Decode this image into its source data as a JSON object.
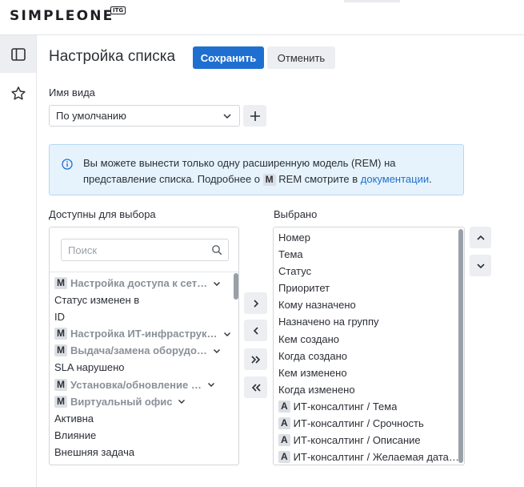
{
  "header": {
    "logo": "SIMPLEONE",
    "logo_badge": "ITG"
  },
  "sidebar": {
    "items": [
      {
        "icon": "panel-icon",
        "active": true
      },
      {
        "icon": "star-icon",
        "active": false
      }
    ]
  },
  "page": {
    "title": "Настройка списка",
    "save_label": "Сохранить",
    "cancel_label": "Отменить"
  },
  "view": {
    "label": "Имя вида",
    "value": "По умолчанию"
  },
  "info": {
    "text_before": "Вы можете вынести только одну расширенную модель (REM) на представление списка. Подробнее о ",
    "badge": "M",
    "text_middle": " REM смотрите в ",
    "link": "документации",
    "text_after": "."
  },
  "available": {
    "label": "Доступны для выбора",
    "search_placeholder": "Поиск",
    "items": [
      {
        "badge": "M",
        "text": "Настройка доступа к сет…",
        "group": true
      },
      {
        "badge": "",
        "text": "Статус изменен в",
        "group": false
      },
      {
        "badge": "",
        "text": "ID",
        "group": false
      },
      {
        "badge": "M",
        "text": "Настройка ИТ-инфраструк…",
        "group": true
      },
      {
        "badge": "M",
        "text": "Выдача/замена оборудо…",
        "group": true
      },
      {
        "badge": "",
        "text": "SLA нарушено",
        "group": false
      },
      {
        "badge": "M",
        "text": "Установка/обновление …",
        "group": true
      },
      {
        "badge": "M",
        "text": "Виртуальный офис",
        "group": true
      },
      {
        "badge": "",
        "text": "Активна",
        "group": false
      },
      {
        "badge": "",
        "text": "Влияние",
        "group": false
      },
      {
        "badge": "",
        "text": "Внешняя задача",
        "group": false
      }
    ]
  },
  "selected": {
    "label": "Выбрано",
    "items": [
      {
        "badge": "",
        "text": "Номер"
      },
      {
        "badge": "",
        "text": "Тема"
      },
      {
        "badge": "",
        "text": "Статус"
      },
      {
        "badge": "",
        "text": "Приоритет"
      },
      {
        "badge": "",
        "text": "Кому назначено"
      },
      {
        "badge": "",
        "text": "Назначено на группу"
      },
      {
        "badge": "",
        "text": "Кем создано"
      },
      {
        "badge": "",
        "text": "Когда создано"
      },
      {
        "badge": "",
        "text": "Кем изменено"
      },
      {
        "badge": "",
        "text": "Когда изменено"
      },
      {
        "badge": "A",
        "text": "ИТ-консалтинг / Тема"
      },
      {
        "badge": "A",
        "text": "ИТ-консалтинг / Срочность"
      },
      {
        "badge": "A",
        "text": "ИТ-консалтинг / Описание"
      },
      {
        "badge": "A",
        "text": "ИТ-консалтинг / Желаемая дата…"
      }
    ]
  },
  "transfer": {
    "move_right": "chevron-right-icon",
    "move_left": "chevron-left-icon",
    "move_all_right": "double-chevron-right-icon",
    "move_all_left": "double-chevron-left-icon"
  },
  "order": {
    "up": "chevron-up-icon",
    "down": "chevron-down-icon"
  },
  "colors": {
    "primary": "#1f6fd1",
    "info_bg": "#e6f3fc",
    "info_border": "#b3d8f3"
  }
}
